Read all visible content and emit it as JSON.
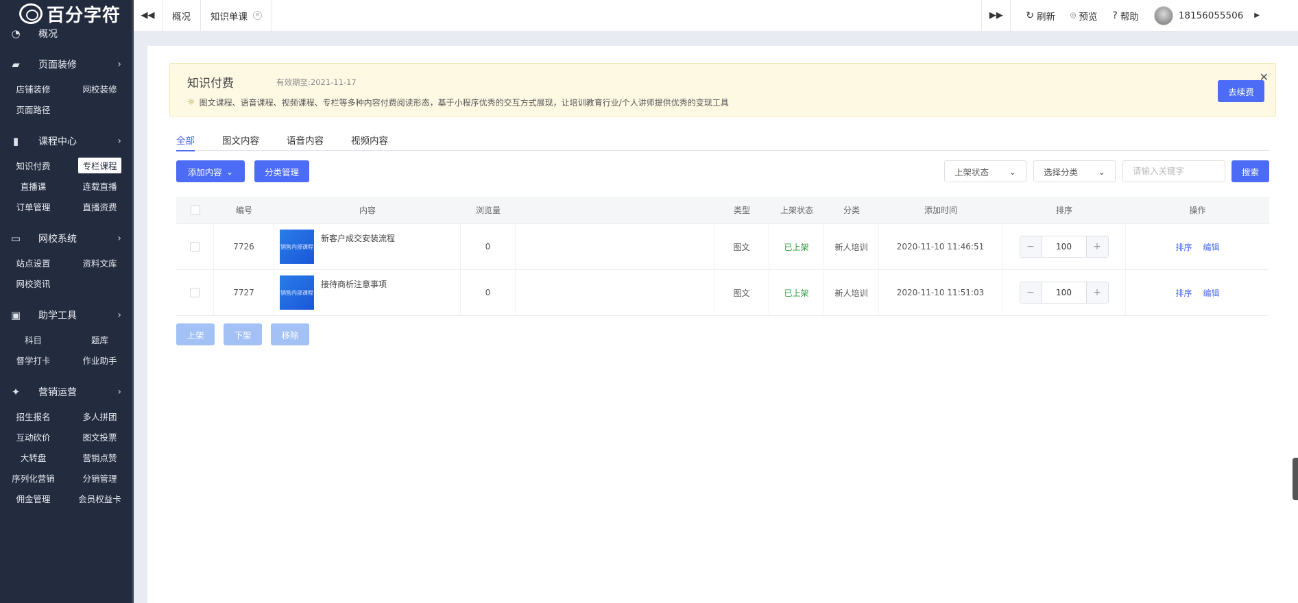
{
  "brand": {
    "logo_text": "百分字符"
  },
  "sidebar": {
    "groups": [
      {
        "label": "概况",
        "icon": "pie-chart-icon",
        "items": []
      },
      {
        "label": "页面装修",
        "icon": "paint-brush-icon",
        "items": [
          "店铺装修",
          "网校装修",
          "页面路径"
        ]
      },
      {
        "label": "课程中心",
        "icon": "book-icon",
        "items": [
          "知识付费",
          "专栏课程",
          "直播课",
          "连载直播",
          "订单管理",
          "直播资费"
        ]
      },
      {
        "label": "网校系统",
        "icon": "monitor-icon",
        "items": [
          "站点设置",
          "资料文库",
          "网校资讯"
        ]
      },
      {
        "label": "助学工具",
        "icon": "briefcase-icon",
        "items": [
          "科目",
          "题库",
          "督学打卡",
          "作业助手"
        ]
      },
      {
        "label": "营销运营",
        "icon": "party-popper-icon",
        "items": [
          "招生报名",
          "多人拼团",
          "互动砍价",
          "图文投票",
          "大转盘",
          "营销点赞",
          "序列化营销",
          "分销管理",
          "佣金管理",
          "会员权益卡"
        ]
      }
    ],
    "active_item": "专栏课程"
  },
  "topbar": {
    "tabs": [
      {
        "label": "概况"
      },
      {
        "label": "知识单课"
      }
    ],
    "actions": {
      "refresh": "刷新",
      "preview": "预览",
      "help": "帮助"
    },
    "user": "18156055506"
  },
  "notice": {
    "title": "知识付费",
    "expire": "有效期至:2021-11-17",
    "desc": "图文课程、语音课程、视频课程、专栏等多种内容付费阅读形态，基于小程序优秀的交互方式展现，让培训教育行业/个人讲师提供优秀的变现工具",
    "renew_label": "去续费"
  },
  "content_tabs": [
    "全部",
    "图文内容",
    "语音内容",
    "视频内容"
  ],
  "toolbar": {
    "add_label": "添加内容",
    "category_label": "分类管理",
    "status_select": "上架状态",
    "category_select": "选择分类",
    "search_placeholder": "请输入关键字",
    "search_label": "搜索"
  },
  "table": {
    "headers": {
      "id": "编号",
      "content": "内容",
      "views": "浏览量",
      "type": "类型",
      "status": "上架状态",
      "category": "分类",
      "time": "添加时间",
      "sort": "排序",
      "ops": "操作"
    },
    "rows": [
      {
        "id": "7726",
        "thumb_text": "销售内部课程",
        "title": "新客户成交安装流程",
        "views": "0",
        "type": "图文",
        "status": "已上架",
        "category": "新人培训",
        "time": "2020-11-10 11:46:51",
        "sort": "100",
        "op_sort": "排序",
        "op_edit": "编辑"
      },
      {
        "id": "7727",
        "thumb_text": "销售内部课程",
        "title": "接待商析注意事项",
        "views": "0",
        "type": "图文",
        "status": "已上架",
        "category": "新人培训",
        "time": "2020-11-10 11:51:03",
        "sort": "100",
        "op_sort": "排序",
        "op_edit": "编辑"
      }
    ]
  },
  "bulk_actions": [
    "上架",
    "下架",
    "移除"
  ],
  "colors": {
    "primary": "#4c6cf5",
    "sidebar_bg": "#232b3e",
    "status_on": "#2e9e3e",
    "notice_bg": "#fdf9e3"
  }
}
